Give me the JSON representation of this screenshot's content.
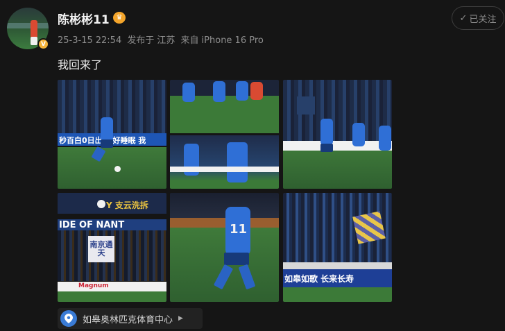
{
  "user": {
    "name": "陈彬彬11",
    "avatar_icon": "avatar-footballer",
    "verified_badge_icon": "verified-v-icon",
    "level_icon": "crown-icon"
  },
  "post": {
    "date": "25-3-15",
    "time": "22:54",
    "location_prefix": "发布于",
    "region": "江苏",
    "source_prefix": "来自",
    "device": "iPhone 16 Pro",
    "text": "我回来了",
    "photo_count": 6
  },
  "follow_button": {
    "label": "已关注",
    "icon": "check-icon"
  },
  "photos": {
    "p1_board": "秒百白0日出 更好睡眠 我",
    "p5_jersey": "11",
    "p4_banner_top": "Y 支云洗拆",
    "p4_banner_mid": "IDE OF NANT",
    "p4_flag": "南京通天",
    "p4_ads": "Magnum",
    "p6_board": "如皋如歌    长来长寿"
  },
  "location_tag": {
    "label": "如皋奥林匹克体育中心",
    "icon": "location-pin-icon",
    "arrow": "chevron-right-icon"
  },
  "colors": {
    "background": "#151515",
    "text": "#e6e6e6",
    "meta": "#8e8e8e",
    "accent_blue": "#3a7bd5",
    "crown": "#f4a52b"
  }
}
